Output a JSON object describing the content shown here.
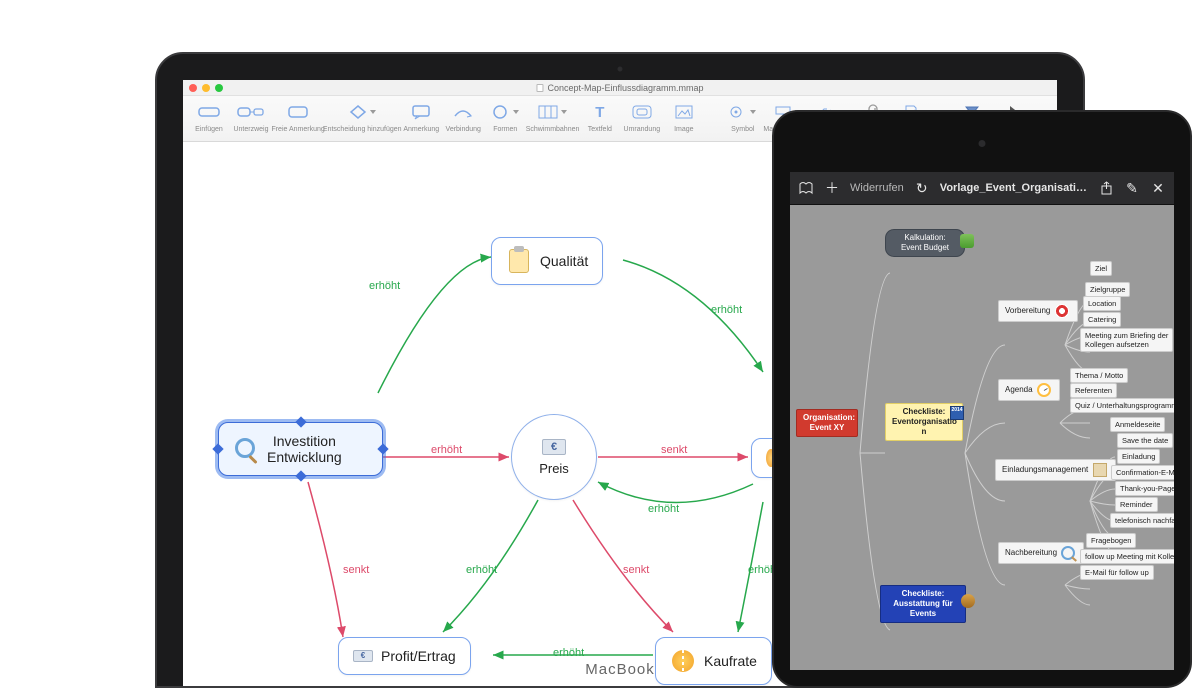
{
  "macbook": {
    "window_title": "Concept-Map-Einflussdiagramm.mmap",
    "device_label": "MacBook",
    "toolbar": {
      "items": [
        {
          "name": "insert",
          "label": "Einfügen"
        },
        {
          "name": "subtopic",
          "label": "Unterzweig"
        },
        {
          "name": "free-note",
          "label": "Freie Anmerkung"
        },
        {
          "name": "add-decision",
          "label": "Entscheidung hinzufügen"
        },
        {
          "name": "annotation",
          "label": "Anmerkung"
        },
        {
          "name": "connection",
          "label": "Verbindung"
        },
        {
          "name": "shapes",
          "label": "Formen"
        },
        {
          "name": "swimlanes",
          "label": "Schwimmbahnen"
        },
        {
          "name": "textfield",
          "label": "Textfeld"
        },
        {
          "name": "border",
          "label": "Umrandung"
        },
        {
          "name": "image",
          "label": "Image"
        },
        {
          "name": "symbol",
          "label": "Symbol"
        },
        {
          "name": "map-rollup",
          "label": "Map-Aufrollung"
        },
        {
          "name": "hyperlink",
          "label": ""
        },
        {
          "name": "attachment",
          "label": ""
        },
        {
          "name": "export",
          "label": ""
        },
        {
          "name": "filter",
          "label": ""
        },
        {
          "name": "cursor",
          "label": ""
        }
      ],
      "overflow": "»"
    },
    "nodes": {
      "qualitaet": "Qualität",
      "investition_l1": "Investition",
      "investition_l2": "Entwicklung",
      "preis": "Preis",
      "profit": "Profit/Ertrag",
      "kaufrate": "Kaufrate"
    },
    "edges": {
      "erhoeht": "erhöht",
      "senkt": "senkt"
    }
  },
  "ipad": {
    "toolbar": {
      "undo": "Widerrufen",
      "filename": "Vorlage_Event_Organisation_mit_Budget_Kalk…"
    },
    "nodes": {
      "kalkulation_l1": "Kalkulation:",
      "kalkulation_l2": "Event Budget",
      "organisation_l1": "Organisation:",
      "organisation_l2": "Event XY",
      "checkliste_l1": "Checkliste:",
      "checkliste_l2": "Eventorganisatio",
      "checkliste_l3": "n",
      "cal_year": "2014",
      "ausstattung_l1": "Checkliste:",
      "ausstattung_l2": "Ausstattung  für",
      "ausstattung_l3": "Events",
      "vorbereitung": "Vorbereitung",
      "agenda": "Agenda",
      "einladung": "Einladungsmanagement",
      "nachbereitung": "Nachbereitung",
      "ziel": "Ziel",
      "zielgruppe": "Zielgruppe",
      "location": "Location",
      "catering": "Catering",
      "meeting_l1": "Meeting zum Briefing der",
      "meeting_l2": "Kollegen aufsetzen",
      "thema": "Thema / Motto",
      "referenten": "Referenten",
      "quiz": "Quiz / Unterhaltungsprogramm",
      "anmeldeseite": "Anmeldeseite",
      "savedate": "Save the date",
      "einladung2": "Einladung",
      "confirm": "Confirmation-E-Mail",
      "thankyou": "Thank-you-Page",
      "reminder": "Reminder",
      "telnach": "telefonisch nachfassen",
      "fragebogen": "Fragebogen",
      "followup": "follow up Meeting mit Kollegen",
      "emailfu": "E-Mail für follow up"
    }
  }
}
